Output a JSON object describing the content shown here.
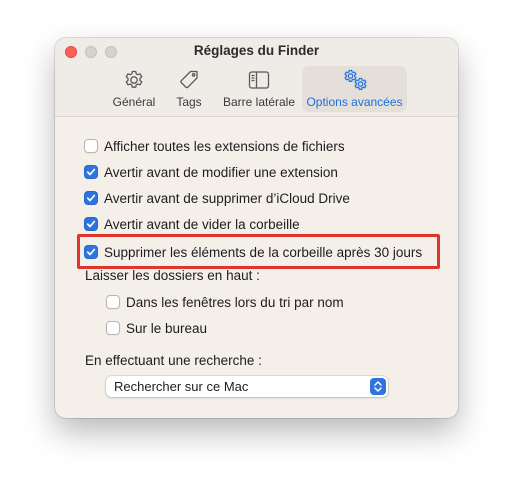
{
  "window": {
    "title": "Réglages du Finder"
  },
  "tabs": [
    {
      "label": "Général",
      "icon": "gear-icon",
      "selected": false
    },
    {
      "label": "Tags",
      "icon": "tag-icon",
      "selected": false
    },
    {
      "label": "Barre latérale",
      "icon": "sidebar-icon",
      "selected": false
    },
    {
      "label": "Options avancées",
      "icon": "gears-icon",
      "selected": true
    }
  ],
  "options": [
    {
      "label": "Afficher toutes les extensions de fichiers",
      "checked": false
    },
    {
      "label": "Avertir avant de modifier une extension",
      "checked": true
    },
    {
      "label": "Avertir avant de supprimer d’iCloud Drive",
      "checked": true
    },
    {
      "label": "Avertir avant de vider la corbeille",
      "checked": true
    },
    {
      "label": "Supprimer les éléments de la corbeille après 30 jours",
      "checked": true
    }
  ],
  "folders_on_top": {
    "heading": "Laisser les dossiers en haut :",
    "options": [
      {
        "label": "Dans les fenêtres lors du tri par nom",
        "checked": false
      },
      {
        "label": "Sur le bureau",
        "checked": false
      }
    ]
  },
  "search": {
    "heading": "En effectuant une recherche :",
    "selected": "Rechercher sur ce Mac"
  },
  "colors": {
    "accent": "#2d74dc",
    "highlight_border": "#e0352b",
    "window_bg": "#f4efe9"
  }
}
